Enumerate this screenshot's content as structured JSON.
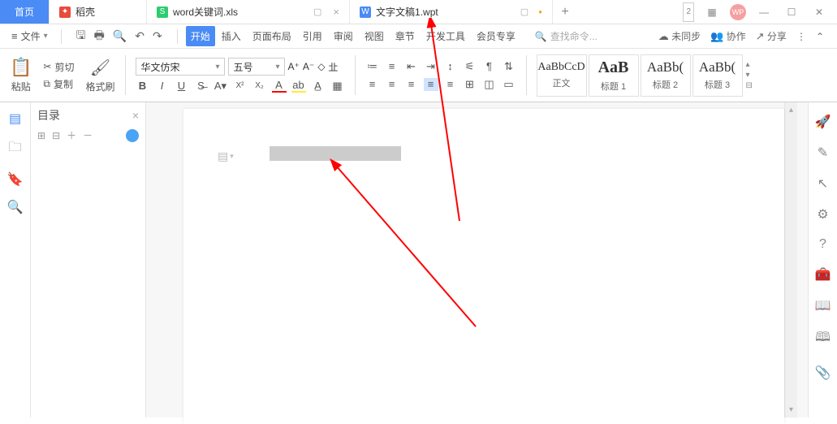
{
  "tabs": {
    "home": "首页",
    "docer": "稻壳",
    "file1": "word关键词.xls",
    "file2": "文字文稿1.wpt"
  },
  "titleButtons": {
    "badge": "2",
    "avatar": "WP"
  },
  "fileMenu": "文件",
  "ribbonTabs": [
    "开始",
    "插入",
    "页面布局",
    "引用",
    "审阅",
    "视图",
    "章节",
    "开发工具",
    "会员专享"
  ],
  "searchPlaceholder": "查找命令...",
  "menuRight": {
    "unsync": "未同步",
    "coop": "协作",
    "share": "分享"
  },
  "clipboard": {
    "paste": "粘贴",
    "cut": "剪切",
    "copy": "复制",
    "brush": "格式刷"
  },
  "font": {
    "family": "华文仿宋",
    "size": "五号"
  },
  "styles": [
    {
      "preview": "AaBbCcD",
      "label": "正文",
      "big": false
    },
    {
      "preview": "AaB",
      "label": "标题 1",
      "big": true
    },
    {
      "preview": "AaBb(",
      "label": "标题 2",
      "big": false
    },
    {
      "preview": "AaBb(",
      "label": "标题 3",
      "big": false
    }
  ],
  "outline": {
    "title": "目录"
  }
}
